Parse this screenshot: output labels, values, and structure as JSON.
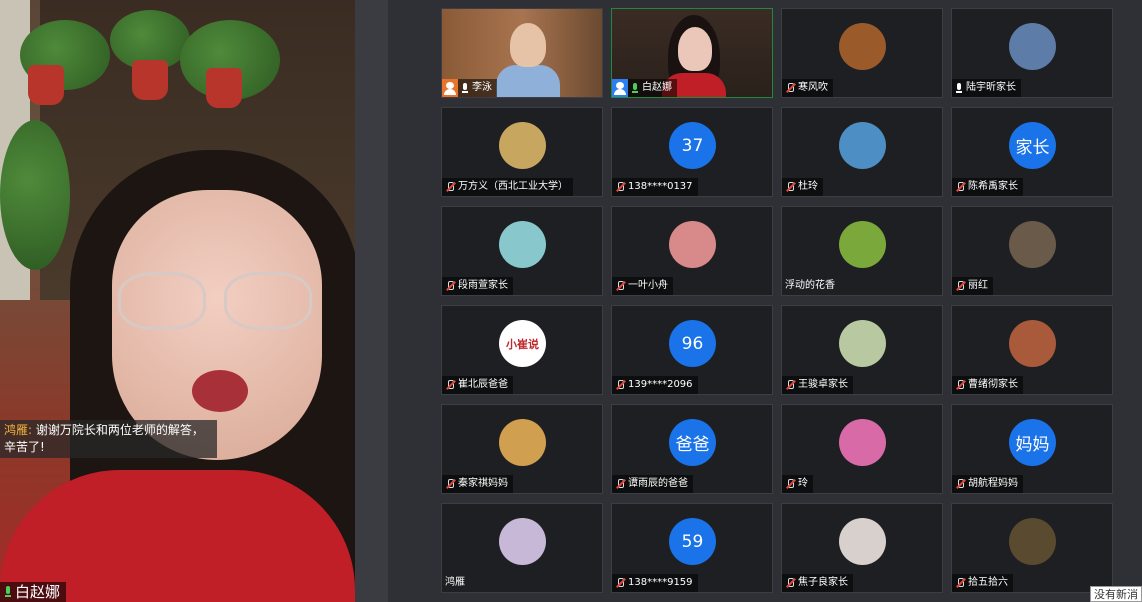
{
  "speaker": {
    "name": "白赵娜",
    "chat_sender": "鸿雁:",
    "chat_message": " 谢谢万院长和两位老师的解答，辛苦了!"
  },
  "participants": [
    {
      "name": "李泳",
      "avatar_text": "",
      "mic": "on",
      "badge": "orange",
      "type": "video1"
    },
    {
      "name": "白赵娜",
      "avatar_text": "",
      "mic": "on-green",
      "badge": "blue",
      "type": "video2",
      "active": true
    },
    {
      "name": "寒风吹",
      "avatar_text": "",
      "mic": "off",
      "avatar_color": "#9a5a2a"
    },
    {
      "name": "陆宇昕家长",
      "avatar_text": "",
      "mic": "on",
      "avatar_color": "#5d7ca8"
    },
    {
      "name": "万方义（西北工业大学）",
      "avatar_text": "",
      "mic": "off",
      "avatar_color": "#c7a760"
    },
    {
      "name": "138****0137",
      "avatar_text": "37",
      "mic": "off",
      "avatar_color": "#1a73e8"
    },
    {
      "name": "杜玲",
      "avatar_text": "",
      "mic": "off",
      "avatar_color": "#4d8fc4"
    },
    {
      "name": "陈希禹家长",
      "avatar_text": "家长",
      "mic": "off",
      "avatar_color": "#1a73e8"
    },
    {
      "name": "段雨萱家长",
      "avatar_text": "",
      "mic": "off",
      "avatar_color": "#88c8cc"
    },
    {
      "name": "一叶小舟",
      "avatar_text": "",
      "mic": "off",
      "avatar_color": "#d88a8a"
    },
    {
      "name": "浮动的花香",
      "avatar_text": "",
      "mic": "none",
      "avatar_color": "#7ba83a"
    },
    {
      "name": "丽红",
      "avatar_text": "",
      "mic": "off",
      "avatar_color": "#6a5a4a"
    },
    {
      "name": "崔北辰爸爸",
      "avatar_text": "小崔说",
      "mic": "off",
      "avatar_color": "#ffffff"
    },
    {
      "name": "139****2096",
      "avatar_text": "96",
      "mic": "off",
      "avatar_color": "#1a73e8"
    },
    {
      "name": "王骏卓家长",
      "avatar_text": "",
      "mic": "off",
      "avatar_color": "#b8c8a0"
    },
    {
      "name": "曹绪彻家长",
      "avatar_text": "",
      "mic": "off",
      "avatar_color": "#a85a3a"
    },
    {
      "name": "秦家祺妈妈",
      "avatar_text": "",
      "mic": "off",
      "avatar_color": "#d0a050"
    },
    {
      "name": "谭雨辰的爸爸",
      "avatar_text": "爸爸",
      "mic": "off",
      "avatar_color": "#1a73e8"
    },
    {
      "name": "玲",
      "avatar_text": "",
      "mic": "off",
      "avatar_color": "#d86aa8"
    },
    {
      "name": "胡航程妈妈",
      "avatar_text": "妈妈",
      "mic": "off",
      "avatar_color": "#1a73e8"
    },
    {
      "name": "鸿雁",
      "avatar_text": "",
      "mic": "none",
      "avatar_color": "#c8b8d8"
    },
    {
      "name": "138****9159",
      "avatar_text": "59",
      "mic": "off",
      "avatar_color": "#1a73e8"
    },
    {
      "name": "焦子良家长",
      "avatar_text": "",
      "mic": "off",
      "avatar_color": "#d8d0cc"
    },
    {
      "name": "拾五拾六",
      "avatar_text": "",
      "mic": "off",
      "avatar_color": "#5a4a30"
    }
  ],
  "notice": "没有新消"
}
